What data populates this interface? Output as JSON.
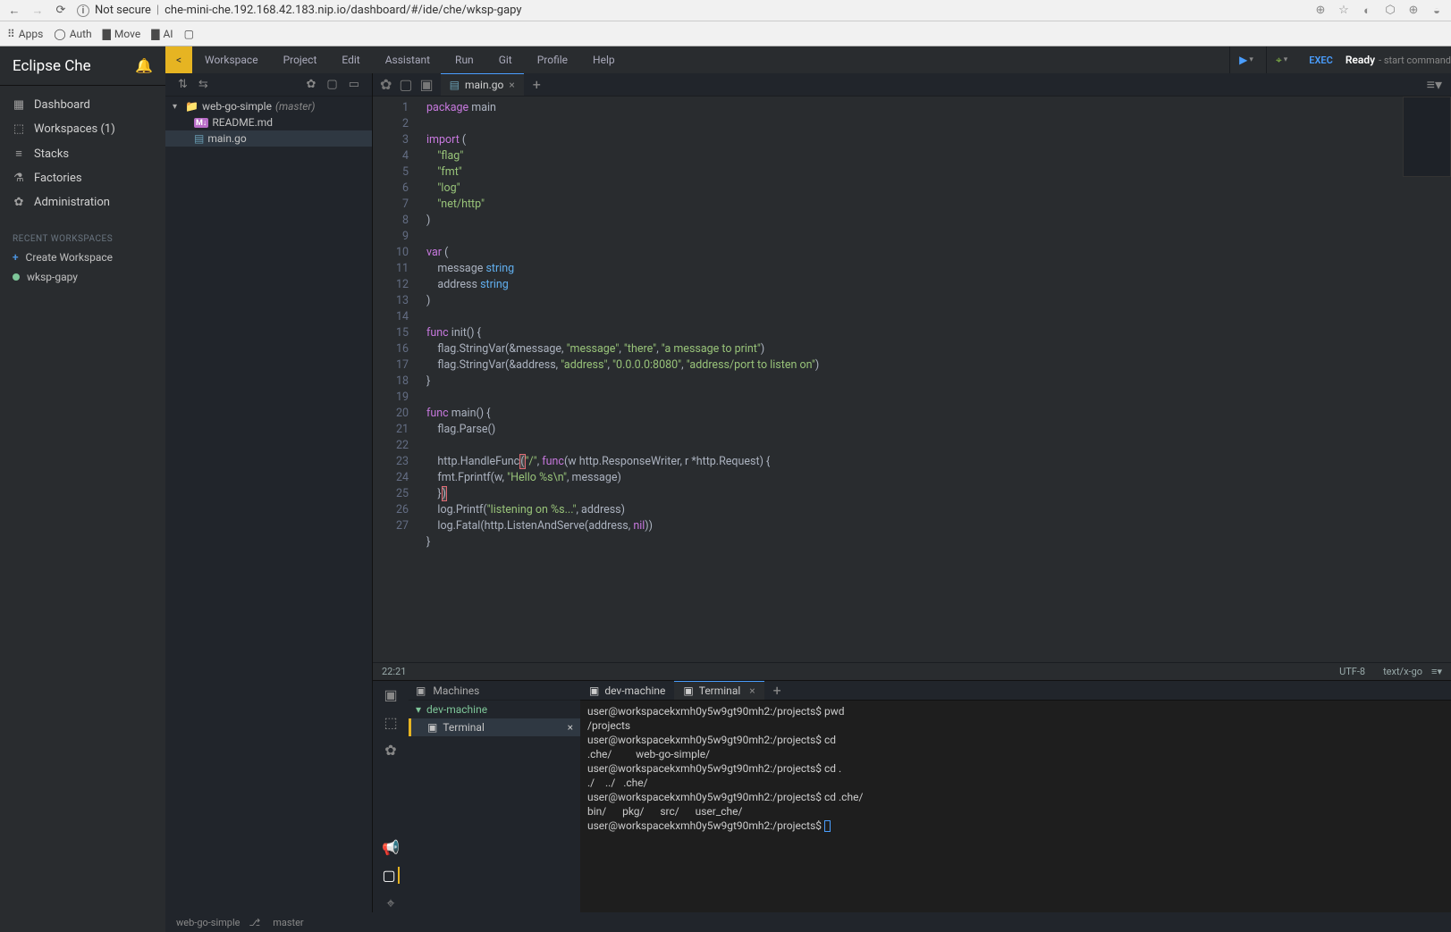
{
  "browser": {
    "insecure_label": "Not secure",
    "url": "che-mini-che.192.168.42.183.nip.io/dashboard/#/ide/che/wksp-gapy",
    "bookmarks": [
      {
        "icon": "⠿",
        "label": "Apps"
      },
      {
        "icon": "◯",
        "label": "Auth"
      },
      {
        "icon": "▇",
        "label": "Move"
      },
      {
        "icon": "▇",
        "label": "AI"
      },
      {
        "icon": "▢",
        "label": ""
      }
    ]
  },
  "sidebar": {
    "brand": "Eclipse Che",
    "nav": [
      {
        "icon": "▦",
        "label": "Dashboard"
      },
      {
        "icon": "⬚",
        "label": "Workspaces (1)"
      },
      {
        "icon": "≡",
        "label": "Stacks"
      },
      {
        "icon": "⚗",
        "label": "Factories"
      },
      {
        "icon": "✿",
        "label": "Administration"
      }
    ],
    "recent_label": "RECENT WORKSPACES",
    "create_label": "Create Workspace",
    "recent": [
      {
        "label": "wksp-gapy"
      }
    ]
  },
  "menubar": {
    "items": [
      "Workspace",
      "Project",
      "Edit",
      "Assistant",
      "Run",
      "Git",
      "Profile",
      "Help"
    ],
    "exec": "EXEC",
    "ready": "Ready",
    "ready_sub": "- start command"
  },
  "explorer": {
    "project": "web-go-simple",
    "branch": "(master)",
    "files": [
      {
        "name": "README.md",
        "type": "md"
      },
      {
        "name": "main.go",
        "type": "go",
        "selected": true
      }
    ]
  },
  "editor": {
    "tab_name": "main.go",
    "cursor": "22:21",
    "encoding": "UTF-8",
    "lang": "text/x-go",
    "highlight_line": 22,
    "lines": [
      {
        "n": 1,
        "t": [
          [
            "kw",
            "package"
          ],
          [
            "id",
            " main"
          ]
        ]
      },
      {
        "n": 2,
        "t": []
      },
      {
        "n": 3,
        "t": [
          [
            "kw",
            "import"
          ],
          [
            "id",
            " ("
          ]
        ]
      },
      {
        "n": 4,
        "t": [
          [
            "id",
            "    "
          ],
          [
            "str",
            "\"flag\""
          ]
        ]
      },
      {
        "n": 5,
        "t": [
          [
            "id",
            "    "
          ],
          [
            "str",
            "\"fmt\""
          ]
        ]
      },
      {
        "n": 6,
        "t": [
          [
            "id",
            "    "
          ],
          [
            "str",
            "\"log\""
          ]
        ]
      },
      {
        "n": 7,
        "t": [
          [
            "id",
            "    "
          ],
          [
            "str",
            "\"net/http\""
          ]
        ]
      },
      {
        "n": 8,
        "t": [
          [
            "id",
            ")"
          ]
        ]
      },
      {
        "n": 9,
        "t": []
      },
      {
        "n": 10,
        "t": [
          [
            "kw",
            "var"
          ],
          [
            "id",
            " ("
          ]
        ]
      },
      {
        "n": 11,
        "t": [
          [
            "id",
            "    message "
          ],
          [
            "typ",
            "string"
          ]
        ]
      },
      {
        "n": 12,
        "t": [
          [
            "id",
            "    address "
          ],
          [
            "typ",
            "string"
          ]
        ]
      },
      {
        "n": 13,
        "t": [
          [
            "id",
            ")"
          ]
        ]
      },
      {
        "n": 14,
        "t": []
      },
      {
        "n": 15,
        "t": [
          [
            "kw",
            "func"
          ],
          [
            "id",
            " init() {"
          ]
        ]
      },
      {
        "n": 16,
        "t": [
          [
            "id",
            "    flag.StringVar(&message, "
          ],
          [
            "str",
            "\"message\""
          ],
          [
            "id",
            ", "
          ],
          [
            "str",
            "\"there\""
          ],
          [
            "id",
            ", "
          ],
          [
            "str",
            "\"a message to print\""
          ],
          [
            "id",
            ")"
          ]
        ]
      },
      {
        "n": 17,
        "t": [
          [
            "id",
            "    flag.StringVar(&address, "
          ],
          [
            "str",
            "\"address\""
          ],
          [
            "id",
            ", "
          ],
          [
            "str",
            "\"0.0.0.0:8080\""
          ],
          [
            "id",
            ", "
          ],
          [
            "str",
            "\"address/port to listen on\""
          ],
          [
            "id",
            ")"
          ]
        ]
      },
      {
        "n": 18,
        "t": [
          [
            "id",
            "}"
          ]
        ]
      },
      {
        "n": 19,
        "t": []
      },
      {
        "n": 20,
        "t": [
          [
            "kw",
            "func"
          ],
          [
            "id",
            " main() {"
          ]
        ]
      },
      {
        "n": 21,
        "t": [
          [
            "id",
            "    flag.Parse()"
          ]
        ]
      },
      {
        "n": 22,
        "t": [
          [
            "id",
            "    http.HandleFunc"
          ],
          [
            "paren",
            "("
          ],
          [
            "str",
            "\"/\""
          ],
          [
            "id",
            ", "
          ],
          [
            "kw",
            "func"
          ],
          [
            "id",
            "(w http.ResponseWriter, r *http.Request) {"
          ]
        ]
      },
      {
        "n": 23,
        "t": [
          [
            "id",
            "    fmt.Fprintf(w, "
          ],
          [
            "str",
            "\"Hello %s\\n\""
          ],
          [
            "id",
            ", message)"
          ]
        ]
      },
      {
        "n": 24,
        "t": [
          [
            "id",
            "    }"
          ],
          [
            "paren",
            ")"
          ]
        ]
      },
      {
        "n": 25,
        "t": [
          [
            "id",
            "    log.Printf("
          ],
          [
            "str",
            "\"listening on %s...\""
          ],
          [
            "id",
            ", address)"
          ]
        ]
      },
      {
        "n": 26,
        "t": [
          [
            "id",
            "    log.Fatal(http.ListenAndServe(address, "
          ],
          [
            "kw",
            "nil"
          ],
          [
            "id",
            "))"
          ]
        ]
      },
      {
        "n": 27,
        "t": [
          [
            "id",
            "}"
          ]
        ]
      }
    ]
  },
  "machines": {
    "label": "Machines",
    "machine_name": "dev-machine",
    "terminal_label": "Terminal",
    "tabs": [
      {
        "label": "dev-machine",
        "icon": "▣"
      },
      {
        "label": "Terminal",
        "icon": "▣",
        "active": true
      }
    ],
    "output": "user@workspacekxmh0y5w9gt90mh2:/projects$ pwd\n/projects\nuser@workspacekxmh0y5w9gt90mh2:/projects$ cd\n.che/         web-go-simple/\nuser@workspacekxmh0y5w9gt90mh2:/projects$ cd .\n./    ../   .che/\nuser@workspacekxmh0y5w9gt90mh2:/projects$ cd .che/\nbin/      pkg/      src/      user_che/\nuser@workspacekxmh0y5w9gt90mh2:/projects$ "
  },
  "footer": {
    "project": "web-go-simple",
    "branch": "master"
  }
}
